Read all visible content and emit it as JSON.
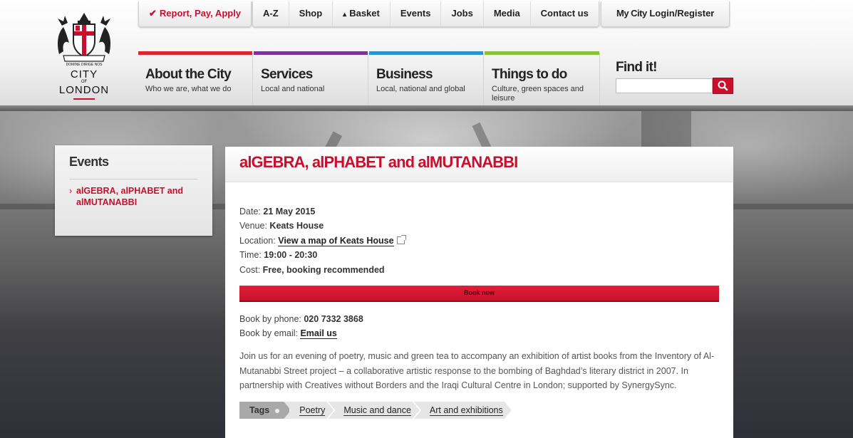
{
  "colors": {
    "brand_red": "#c8102e",
    "nav_about": "#d7282f",
    "nav_services": "#7b3594",
    "nav_business": "#2a95c8",
    "nav_things": "#8ac23c"
  },
  "logo": {
    "line1": "CITY",
    "line2": "OF",
    "line3": "LONDON",
    "motto": "DOMINE DIRIGE NOS",
    "icon": "city-of-london-crest"
  },
  "utility_nav": {
    "report": "Report, Pay, Apply",
    "items": [
      "A-Z",
      "Shop",
      "Basket",
      "Events",
      "Jobs",
      "Media",
      "Contact us"
    ],
    "mycity_brand": "My City",
    "mycity_link": "Login/Register"
  },
  "main_nav": [
    {
      "title": "About the City",
      "subtitle": "Who we are, what we do"
    },
    {
      "title": "Services",
      "subtitle": "Local and national"
    },
    {
      "title": "Business",
      "subtitle": "Local, national and global"
    },
    {
      "title": "Things to do",
      "subtitle": "Culture, green spaces and leisure"
    }
  ],
  "search": {
    "label": "Find it!",
    "placeholder": "",
    "value": ""
  },
  "sidebar": {
    "title": "Events",
    "items": [
      "alGEBRA, alPHABET and alMUTANABBI"
    ]
  },
  "event": {
    "title": "alGEBRA, alPHABET and alMUTANABBI",
    "date_label": "Date:",
    "date": "21 May 2015",
    "venue_label": "Venue:",
    "venue": "Keats House",
    "location_label": "Location:",
    "location_link": "View a map of Keats House",
    "time_label": "Time:",
    "time": "19:00 - 20:30",
    "cost_label": "Cost:",
    "cost": "Free, booking recommended",
    "book_button": "Book now",
    "phone_label": "Book by phone:",
    "phone": "020 7332 3868",
    "email_label": "Book by email:",
    "email_link": "Email us",
    "description": "Join us for an evening of poetry, music and green tea to accompany an exhibition of artist books from the Inventory of Al-Mutanabbi Street project – a collaborative artistic response to the bombing of Baghdad’s literary district in 2007. In partnership with Creatives without Borders and the Iraqi Cultural Centre in London; supported by SynergySync."
  },
  "tags": {
    "label": "Tags",
    "items": [
      "Poetry",
      "Music and dance",
      "Art and exhibitions"
    ]
  }
}
